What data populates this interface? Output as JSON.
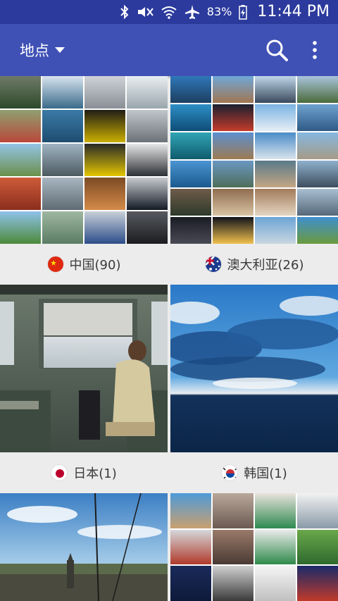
{
  "status": {
    "battery": "83%",
    "time": "11:44 PM"
  },
  "appbar": {
    "title": "地点"
  },
  "places": [
    {
      "label": "中国(90)",
      "flag": "china"
    },
    {
      "label": "澳大利亚(26)",
      "flag": "australia"
    },
    {
      "label": "日本(1)",
      "flag": "japan"
    },
    {
      "label": "韩国(1)",
      "flag": "korea"
    }
  ],
  "colors": {
    "statusbar": "#2b3a9c",
    "appbar": "#3f51b5",
    "background": "#ececec"
  }
}
